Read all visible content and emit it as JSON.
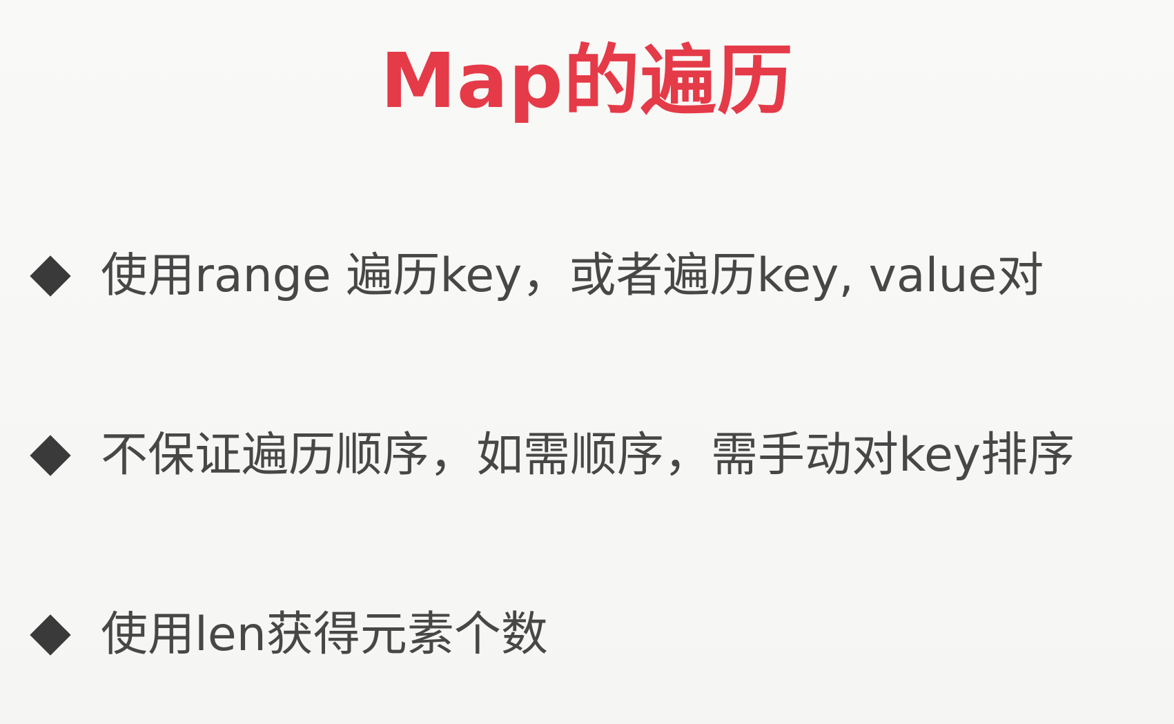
{
  "slide": {
    "title": "Map的遍历",
    "bullets": [
      "使用range 遍历key，或者遍历key, value对",
      "不保证遍历顺序，如需顺序，需手动对key排序",
      "使用len获得元素个数"
    ]
  },
  "colors": {
    "title": "#e53a48",
    "text": "#474747",
    "bullet_icon": "#3a3a3a",
    "background": "#f7f7f5"
  },
  "icons": {
    "bullet": "diamond-icon"
  }
}
